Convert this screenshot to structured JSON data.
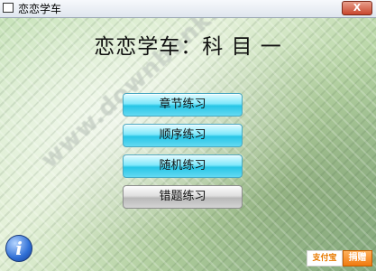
{
  "window": {
    "title": "恋恋学车",
    "close_label": "X"
  },
  "heading": "恋恋学车：科 目 一",
  "watermark": "www.downbank.cn",
  "menu": [
    {
      "label": "章节练习"
    },
    {
      "label": "顺序练习"
    },
    {
      "label": "随机练习"
    },
    {
      "label": "错题练习"
    }
  ],
  "info_icon": {
    "glyph": "i",
    "icon": "info-icon"
  },
  "footer": {
    "pay_label": "支付宝",
    "donate_label": "捐赠"
  },
  "colors": {
    "menu_button": "#27c5e6",
    "menu_button_inactive": "#b9b9b9",
    "close_button": "#c8452c",
    "donate_button": "#f07a10"
  }
}
